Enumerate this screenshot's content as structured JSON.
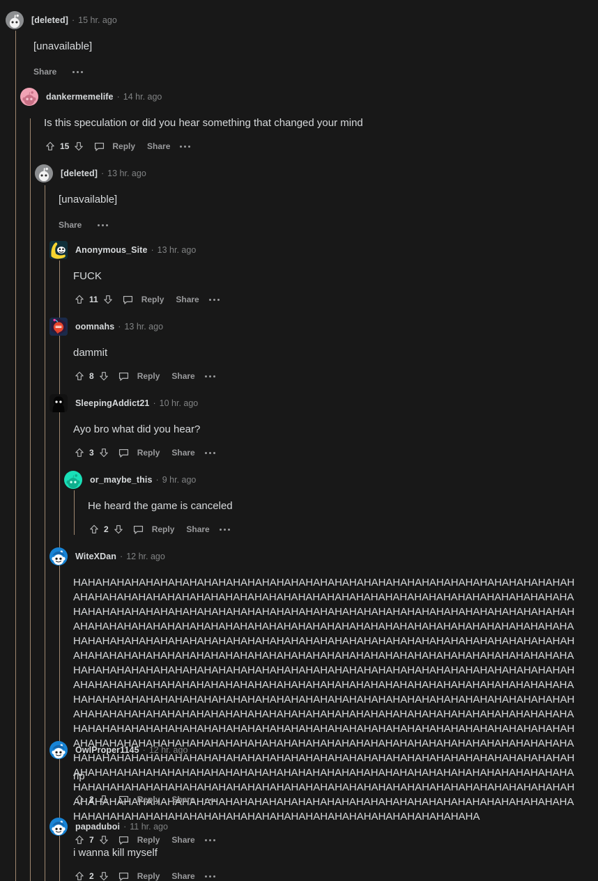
{
  "theme": {
    "background": "#181818",
    "text": "#d7dadc",
    "muted": "#818384",
    "action": "#9a9b9d",
    "rail": "#a08870"
  },
  "labels": {
    "reply": "Reply",
    "share": "Share",
    "separator": "·",
    "upvote_icon": "upvote-arrow-icon",
    "downvote_icon": "downvote-arrow-icon",
    "comment_icon": "comment-bubble-icon",
    "more_icon": "more-options-icon"
  },
  "comments": [
    {
      "id": "c0",
      "author": "[deleted]",
      "timestamp": "15 hr. ago",
      "body": "[unavailable]",
      "score": null,
      "deleted": true,
      "avatar": "snoo-grey",
      "depth": 0
    },
    {
      "id": "c1",
      "author": "dankermemelife",
      "timestamp": "14 hr. ago",
      "body": "Is this speculation or did you hear something that changed your mind",
      "score": "15",
      "deleted": false,
      "avatar": "snoo-pink",
      "depth": 1
    },
    {
      "id": "c2",
      "author": "[deleted]",
      "timestamp": "13 hr. ago",
      "body": "[unavailable]",
      "score": null,
      "deleted": true,
      "avatar": "snoo-grey",
      "depth": 2
    },
    {
      "id": "c3",
      "author": "Anonymous_Site",
      "timestamp": "13 hr. ago",
      "body": "FUCK",
      "score": "11",
      "deleted": false,
      "avatar": "banana",
      "depth": 3
    },
    {
      "id": "c4",
      "author": "oomnahs",
      "timestamp": "13 hr. ago",
      "body": "dammit",
      "score": "8",
      "deleted": false,
      "avatar": "red-bomb",
      "depth": 3
    },
    {
      "id": "c5",
      "author": "SleepingAddict21",
      "timestamp": "10 hr. ago",
      "body": "Ayo bro what did you hear?",
      "score": "3",
      "deleted": false,
      "avatar": "shadow",
      "depth": 3
    },
    {
      "id": "c6",
      "author": "or_maybe_this",
      "timestamp": "9 hr. ago",
      "body": "He heard the game is canceled",
      "score": "2",
      "deleted": false,
      "avatar": "snoo-teal",
      "depth": 4
    },
    {
      "id": "c7",
      "author": "WiteXDan",
      "timestamp": "12 hr. ago",
      "body": "HAHAHAHAHAHAHAHAHAHAHAHAHAHAHAHAHAHAHAHAHAHAHAHAHAHAHAHAHAHAHAHAHAHAHAHAHAHAHAHAHAHAHAHAHAHAHAHAHAHAHAHAHAHAHAHAHAHAHAHAHAHAHAHAHAHAHAHAHAHAHAHAHAHAHAHAHAHAHAHAHAHAHAHAHAHAHAHAHAHAHAHAHAHAHAHAHAHAHAHAHAHAHAHAHAHAHAHAHAHAHAHAHAHAHAHAHAHAHAHAHAHAHAHAHAHAHAHAHAHAHAHAHAHAHAHAHAHAHAHAHAHAHAHAHAHAHAHAHAHAHAHAHAHAHAHAHAHAHAHAHAHAHAHAHAHAHAHAHAHAHAHAHAHAHAHAHAHAHAHAHAHAHAHAHAHAHAHAHAHAHAHAHAHAHAHAHAHAHAHAHAHAHAHAHAHAHAHAHAHAHAHAHAHAHAHAHAHAHAHAHAHAHAHAHAHAHAHAHAHAHAHAHAHAHAHAHAHAHAHAHAHAHAHAHAHAHAHAHAHAHAHAHAHAHAHAHAHAHAHAHAHAHAHAHAHAHAHAHAHAHAHAHAHAHAHAHAHAHAHAHAHAHAHAHAHAHAHAHAHAHAHAHAHAHAHAHAHAHAHAHAHAHAHAHAHAHAHAHAHAHAHAHAHAHAHAHAHAHAHAHAHAHAHAHAHAHAHAHAHAHAHAHAHAHAHAHAHAHAHAHAHAHAHAHAHAHAHAHAHAHAHAHAHAHAHAHAHAHAHAHAHAHAHAHAHAHAHAHAHAHAHAHAHAHAHAHAHAHAHAHAHAHAHAHAHAHAHAHAHAHAHAHAHAHAHAHAHAHAHAHAHAHAHAHAHAHAHAHAHAHAHAHAHAHAHAHAHAHAHAHAHAHAHAHAHAHAHAHAHAHAHAHAHAHAHAHAHAHAHAHAHAHAHAHAHAHAHAHAHAHAHAHAHAHAHAHAHAHAHAHAHAHAHAHAHAHAHAHAHAHAHAHAHAHAHAHAHAHAHAHAHAHAHAHAHAHAHAHAHAHAHAHAHAHAHAHAHAHAHAHAHAHAHAHAHAHAHAHAHAHAHAHAHAHAHAHAHAHAHAHAHAHAHAHAHAHAHAHAHAHAHAHAHAHAHAHAHAHAHAHAHAHAHAHAHAHAHAHAHAHAHAHAHAHAHAHAHAHAHAHAHAHAHAHAHAHAHAHAHAHAHAHAHAHAHAHAHAHAHA",
      "score": "7",
      "deleted": false,
      "avatar": "snoo-blue",
      "depth": 3
    },
    {
      "id": "c8",
      "author": "OwlProper1145",
      "timestamp": "12 hr. ago",
      "body": "rip",
      "score": "2",
      "deleted": false,
      "avatar": "snoo-blue",
      "depth": 3
    },
    {
      "id": "c9",
      "author": "papaduboi",
      "timestamp": "11 hr. ago",
      "body": "i wanna kill myself",
      "score": "2",
      "deleted": false,
      "avatar": "snoo-blue",
      "depth": 3
    }
  ]
}
